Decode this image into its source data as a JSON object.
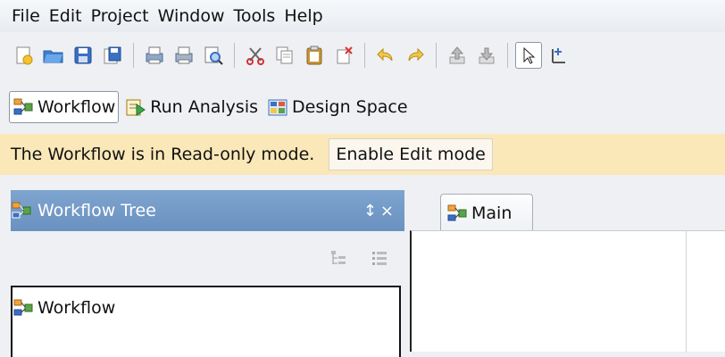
{
  "menu": [
    "File",
    "Edit",
    "Project",
    "Window",
    "Tools",
    "Help"
  ],
  "toolbar_icons": [
    "new-file-icon",
    "open-folder-icon",
    "save-icon",
    "save-all-icon",
    "print-setup-icon",
    "print-icon",
    "print-preview-icon",
    "cut-icon",
    "copy-icon",
    "paste-icon",
    "delete-icon",
    "undo-icon",
    "redo-icon",
    "move-up-icon",
    "move-down-icon",
    "select-pointer-icon",
    "align-icon"
  ],
  "views": {
    "workflow": "Workflow",
    "run_analysis": "Run Analysis",
    "design_space": "Design Space"
  },
  "banner": {
    "message": "The Workflow is in Read-only mode.",
    "button": "Enable Edit mode"
  },
  "tree_panel": {
    "title": "Workflow Tree",
    "pin": "↕",
    "close": "×",
    "root_node": "Workflow"
  },
  "editor": {
    "tab_label": "Main"
  },
  "colors": {
    "banner_bg": "#fbe8b8",
    "panel_header": "#7ea4cf"
  }
}
